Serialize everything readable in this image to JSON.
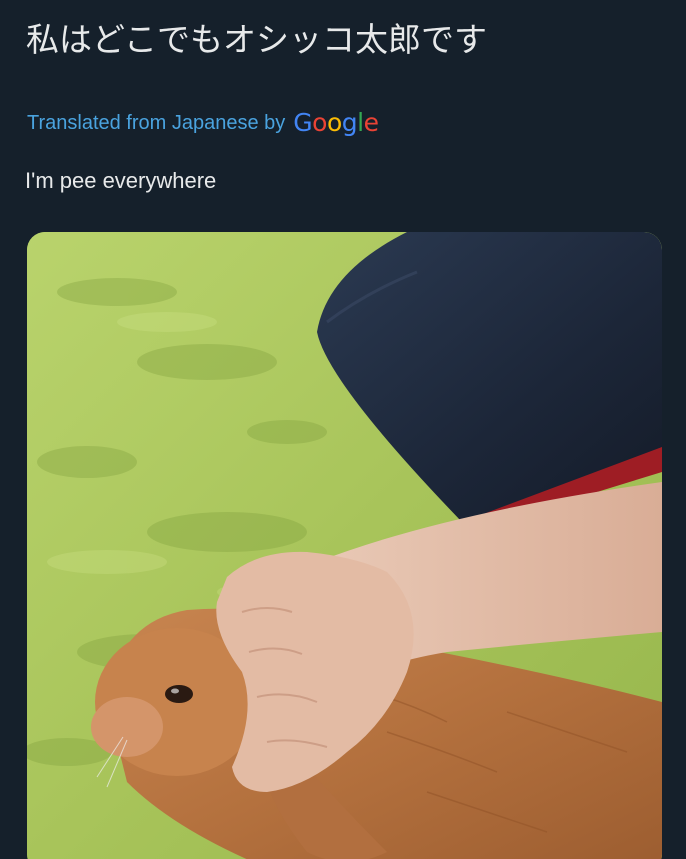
{
  "tweet": {
    "text_original": "私はどこでもオシッコ太郎です",
    "translated_label": "Translated from Japanese by",
    "translation_provider": "Google",
    "text_translated": "I'm pee everywhere"
  },
  "media": {
    "icon": "photo-rabbit-held-by-hand"
  },
  "colors": {
    "background": "#15202b",
    "text": "#e7e9ea",
    "link": "#4aa3df",
    "google_blue": "#4285f4",
    "google_red": "#ea4335",
    "google_yellow": "#fbbc05",
    "google_green": "#34a853"
  }
}
